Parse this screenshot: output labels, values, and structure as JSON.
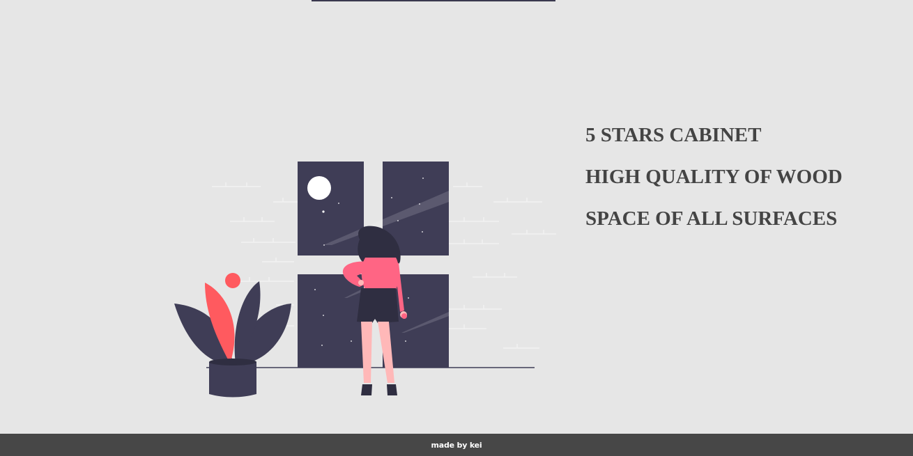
{
  "features": [
    "5 STARS CABINET",
    "HIGH QUALITY OF WOOD",
    "SPACE OF ALL SURFACES"
  ],
  "footer": {
    "credit": "made by kei"
  },
  "colors": {
    "background": "#e6e6e6",
    "dark": "#3f3d56",
    "accent": "#ff6584",
    "plant_accent": "#ff5a5f",
    "footer": "#474747"
  }
}
